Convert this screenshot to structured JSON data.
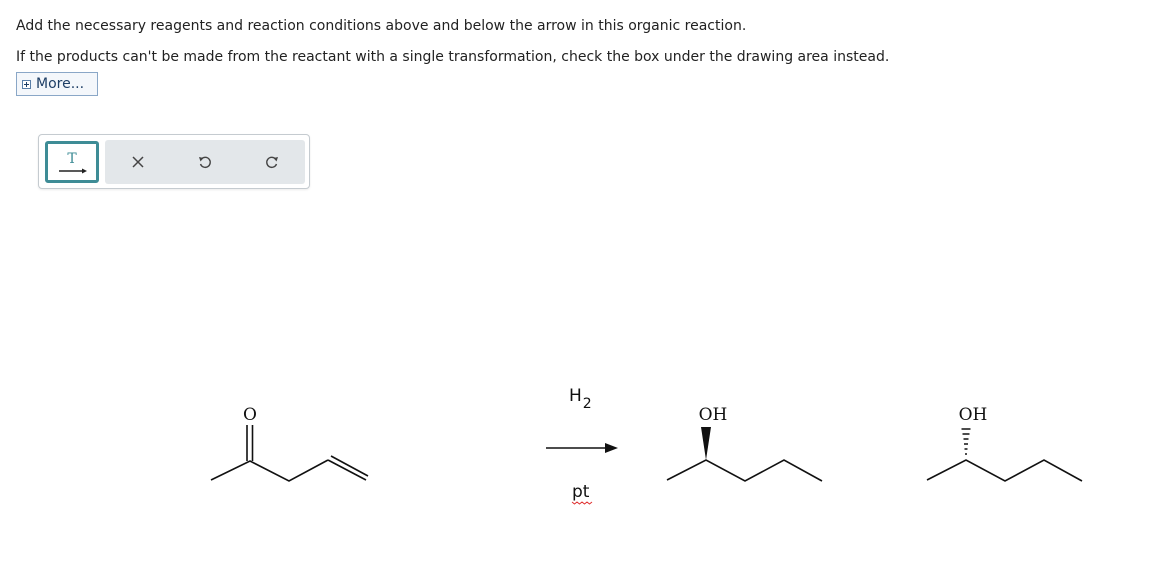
{
  "instructions": {
    "line1": "Add the necessary reagents and reaction conditions above and below the arrow in this organic reaction.",
    "line2": "If the products can't be made from the reactant with a single transformation, check the box under the drawing area instead."
  },
  "more_button": {
    "label": "More..."
  },
  "toolbar": {
    "text_tool_icon": "T",
    "tools": [
      "text-arrow-icon",
      "close-icon",
      "undo-icon",
      "redo-icon"
    ]
  },
  "reaction": {
    "reactant_atom_label": "O",
    "reagent_above": {
      "base": "H",
      "subscript": "2"
    },
    "reagent_below": "pt",
    "product1_label": "OH",
    "product2_label": "OH"
  },
  "colors": {
    "accent": "#3e8c96",
    "link_border": "#8aa7c7",
    "spellcheck": "#e03030"
  }
}
